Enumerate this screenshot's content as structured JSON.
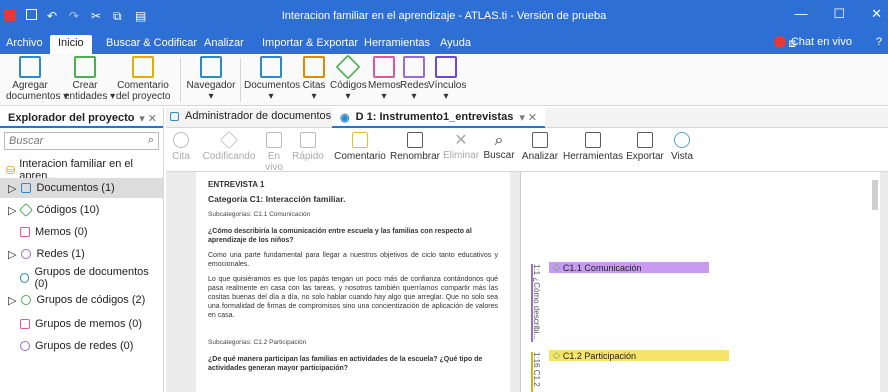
{
  "window": {
    "title": "Interacion familiar en el aprendizaje - ATLAS.ti - Versión de prueba"
  },
  "ribbon_tabs": [
    "Archivo",
    "Inicio",
    "Buscar & Codificar",
    "Analizar",
    "Importar & Exportar",
    "Herramientas",
    "Ayuda"
  ],
  "chat": {
    "label": "Chat en vivo"
  },
  "ribbon": {
    "agregar": "Agregar\ndocumentos ▾",
    "crear": "Crear\nentidades ▾",
    "comentario": "Comentario\ndel proyecto",
    "navegador": "Navegador\n▾",
    "documentos": "Documentos\n▾",
    "citas": "Citas\n▾",
    "codigos": "Códigos\n▾",
    "memos": "Memos\n▾",
    "redes": "Redes\n▾",
    "vinculos": "Vínculos\n▾"
  },
  "explorer": {
    "title": "Explorador del proyecto",
    "search_placeholder": "Buscar",
    "project": "Interacion familiar en el apren...",
    "items": [
      {
        "label": "Documentos (1)"
      },
      {
        "label": "Códigos (10)"
      },
      {
        "label": "Memos (0)"
      },
      {
        "label": "Redes (1)"
      },
      {
        "label": "Grupos de documentos (0)"
      },
      {
        "label": "Grupos de códigos (2)"
      },
      {
        "label": "Grupos de memos (0)"
      },
      {
        "label": "Grupos de redes (0)"
      }
    ]
  },
  "doc_tabs": {
    "admin": "Administrador de documentos",
    "doc": "D 1: Instrumento1_entrevistas"
  },
  "doc_toolbar": {
    "cita": "Cita",
    "codificando": "Codificando",
    "envivo": "En vivo",
    "rapido": "Rápido",
    "comentario": "Comentario",
    "renombrar": "Renombrar",
    "eliminar": "Eliminar",
    "buscar": "Buscar",
    "analizar": "Analizar",
    "herramientas": "Herramientas",
    "exportar": "Exportar",
    "vista": "Vista"
  },
  "document": {
    "heading": "ENTREVISTA 1",
    "category": "Categoría C1: Interacción familiar.",
    "sub1": "Subcategorías: C1.1 Comunicación",
    "q1": "¿Cómo describiría la comunicación entre escuela y las familias con respecto al aprendizaje de los niños?",
    "p1": "Como una parte fundamental para llegar a nuestros objetivos de ciclo tanto educativos y emocionales.",
    "p2": "Lo que quisiéramos es que los papás tengan un poco más de confianza contándonos qué pasa realmente en casa con las tareas, y nosotros también querríamos compartir más las cositas buenas del día a día, no solo hablar cuando hay algo que arreglar. Que no solo sea una formalidad de firmas de compromisos sino una concientización de aplicación de valores en casa.",
    "sub2": "Subcategorías: C1.2 Participación",
    "q2": "¿De qué manera participan las familias en actividades de la escuela? ¿Qué tipo de actividades generan mayor participación?"
  },
  "margin": {
    "code1": "C1.1 Comunicación",
    "quote1": "1:1 ¿Cómo describi...",
    "code2": "C1.2 Participación",
    "quote2": "1:16 C1.2"
  },
  "colors": {
    "accent": "#2e6fd6",
    "code1_bg": "#c89af0",
    "code2_bg": "#f7e26b"
  }
}
